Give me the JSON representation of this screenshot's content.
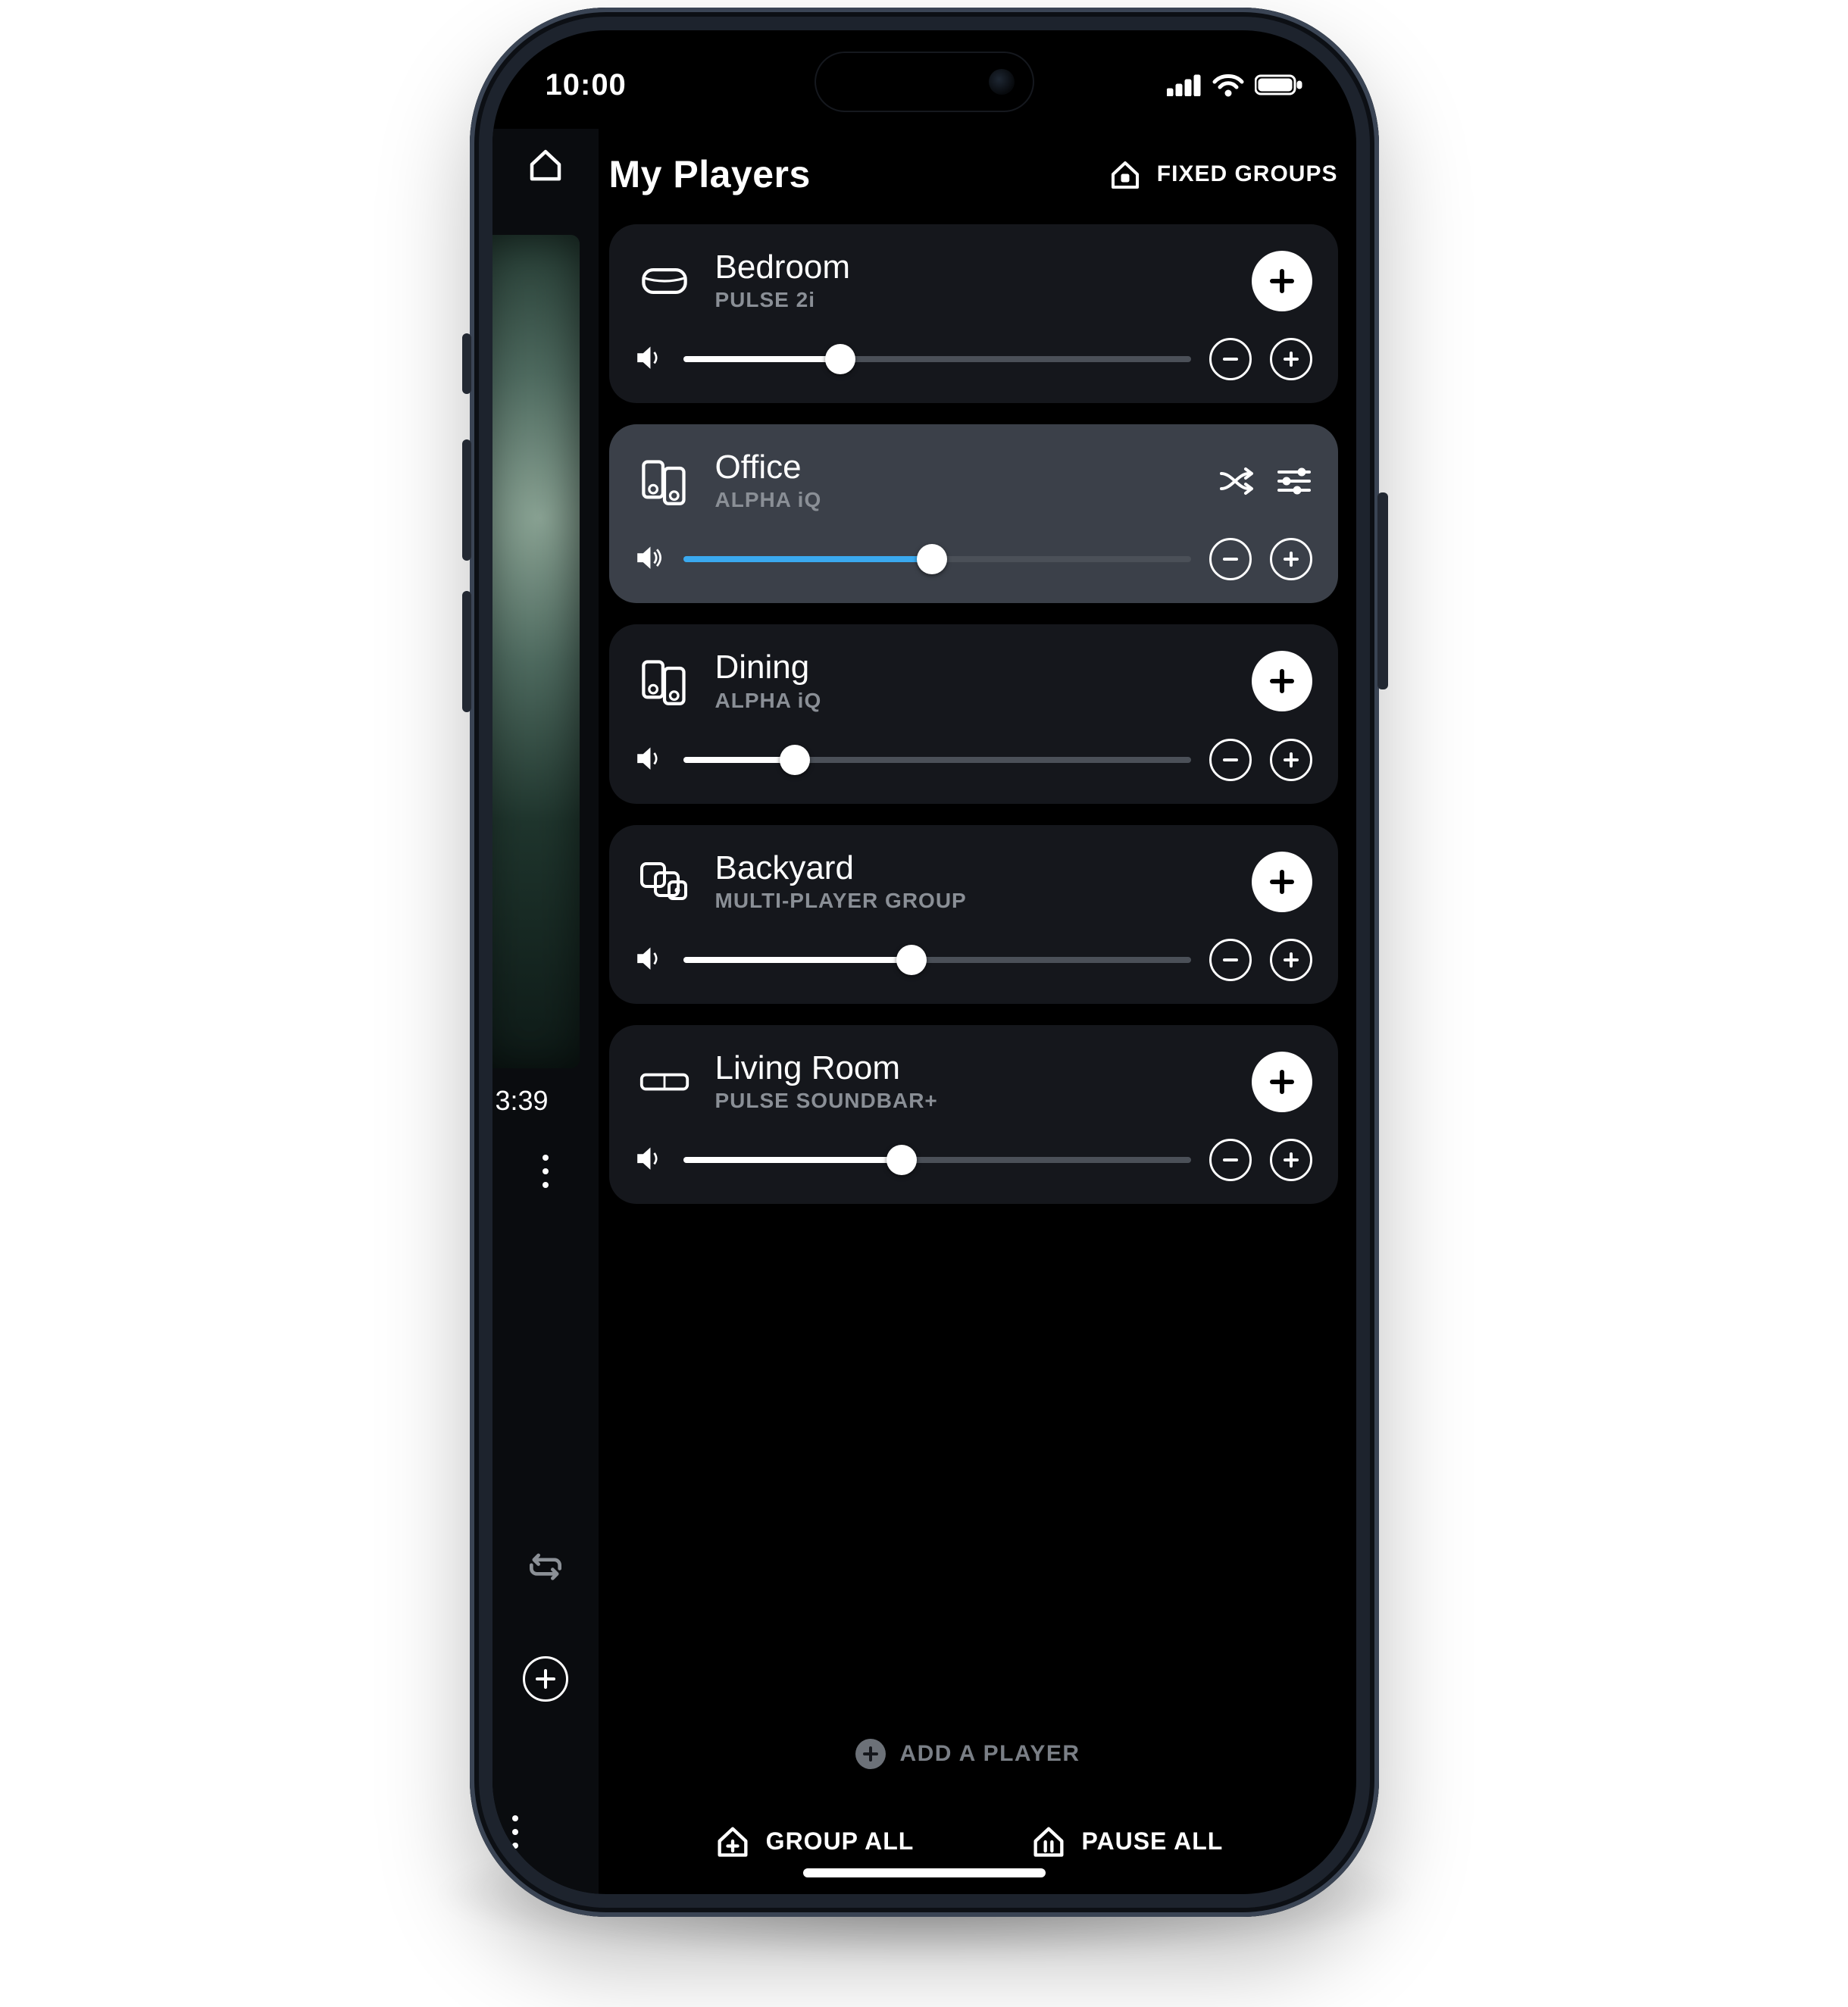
{
  "status": {
    "time": "10:00"
  },
  "header": {
    "title": "My Players",
    "fixed_groups_label": "FIXED GROUPS"
  },
  "colors": {
    "accent": "#3aa9ef",
    "fill_default": "#FFFFFF"
  },
  "rail": {
    "elapsed": "3:39"
  },
  "players": [
    {
      "name": "Bedroom",
      "model": "PULSE 2i",
      "icon": "pulse",
      "active": false,
      "volume_pct": 31,
      "fill_color": "#FFFFFF"
    },
    {
      "name": "Office",
      "model": "ALPHA iQ",
      "icon": "alpha",
      "active": true,
      "volume_pct": 49,
      "fill_color": "#3aa9ef",
      "show_shuffle_sliders": true
    },
    {
      "name": "Dining",
      "model": "ALPHA iQ",
      "icon": "alpha",
      "active": false,
      "volume_pct": 22,
      "fill_color": "#FFFFFF"
    },
    {
      "name": "Backyard",
      "model": "MULTI-PLAYER GROUP",
      "icon": "group",
      "active": false,
      "volume_pct": 45,
      "fill_color": "#FFFFFF"
    },
    {
      "name": "Living Room",
      "model": "PULSE SOUNDBAR+",
      "icon": "soundbar",
      "active": false,
      "volume_pct": 43,
      "fill_color": "#FFFFFF"
    }
  ],
  "add_player_label": "ADD A PLAYER",
  "footer": {
    "group_all": "GROUP ALL",
    "pause_all": "PAUSE ALL"
  }
}
